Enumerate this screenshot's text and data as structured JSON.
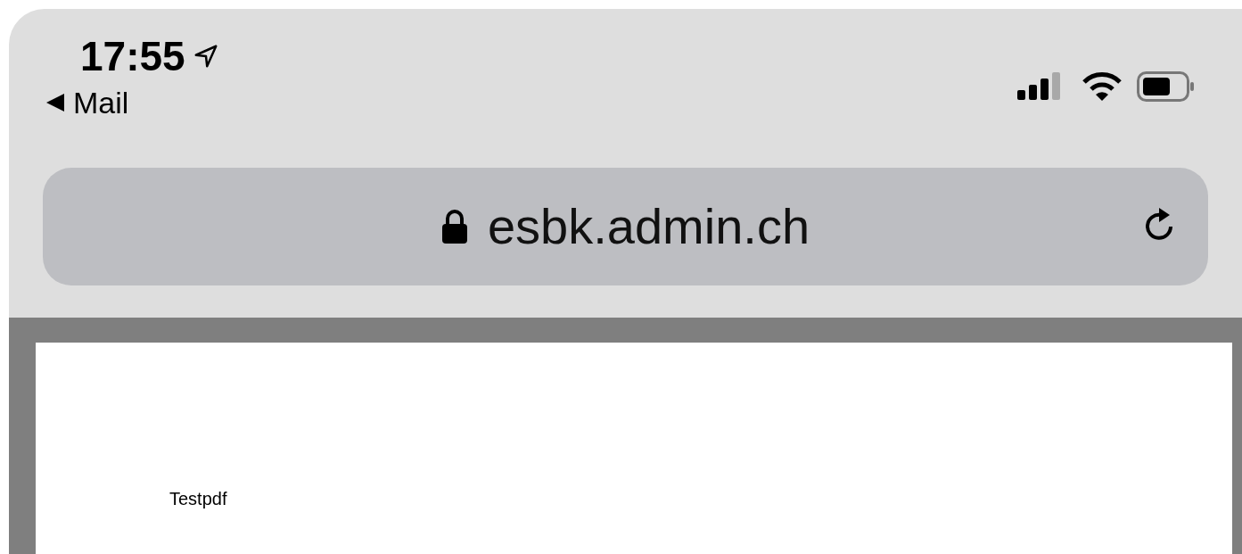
{
  "status_bar": {
    "time": "17:55",
    "back_label": "Mail"
  },
  "address_bar": {
    "url": "esbk.admin.ch"
  },
  "document": {
    "text": "Testpdf"
  }
}
